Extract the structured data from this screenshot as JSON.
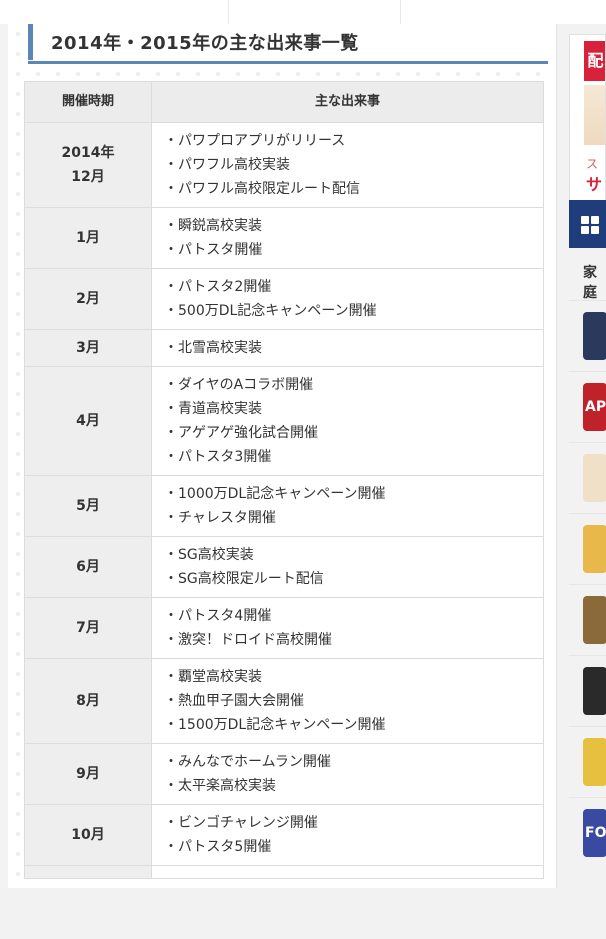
{
  "heading": {
    "title": "2014年・2015年の主な出来事一覧"
  },
  "table": {
    "headers": {
      "period": "開催時期",
      "events": "主な出来事"
    },
    "rows": [
      {
        "period": [
          "2014年",
          "12月"
        ],
        "events": [
          "・パワプロアプリがリリース",
          "・パワフル高校実装",
          "・パワフル高校限定ルート配信"
        ]
      },
      {
        "period": [
          "1月"
        ],
        "events": [
          "・瞬鋭高校実装",
          "・パトスタ開催"
        ]
      },
      {
        "period": [
          "2月"
        ],
        "events": [
          "・パトスタ2開催",
          "・500万DL記念キャンペーン開催"
        ]
      },
      {
        "period": [
          "3月"
        ],
        "events": [
          "・北雪高校実装"
        ]
      },
      {
        "period": [
          "4月"
        ],
        "events": [
          "・ダイヤのAコラボ開催",
          "・青道高校実装",
          "・アゲアゲ強化試合開催",
          "・パトスタ3開催"
        ]
      },
      {
        "period": [
          "5月"
        ],
        "events": [
          "・1000万DL記念キャンペーン開催",
          "・チャレスタ開催"
        ]
      },
      {
        "period": [
          "6月"
        ],
        "events": [
          "・SG高校実装",
          "・SG高校限定ルート配信"
        ]
      },
      {
        "period": [
          "7月"
        ],
        "events": [
          "・パトスタ4開催",
          "・激突！ドロイド高校開催"
        ]
      },
      {
        "period": [
          "8月"
        ],
        "events": [
          "・覇堂高校実装",
          "・熱血甲子園大会開催",
          "・1500万DL記念キャンペーン開催"
        ]
      },
      {
        "period": [
          "9月"
        ],
        "events": [
          "・みんなでホームラン開催",
          "・太平楽高校実装"
        ]
      },
      {
        "period": [
          "10月"
        ],
        "events": [
          "・ビンゴチャレンジ開催",
          "・パトスタ5開催"
        ]
      },
      {
        "period": [
          ""
        ],
        "events": [
          ""
        ]
      }
    ]
  },
  "sidebar": {
    "banner_text_top": "配",
    "banner_text_mid": "ス",
    "banner_text_bottom": "サ",
    "section_label": "家庭",
    "thumbs": [
      {
        "label": "",
        "color": "#2b3a5c"
      },
      {
        "label": "AP",
        "color": "#c0222a"
      },
      {
        "label": "",
        "color": "#f0e0c8"
      },
      {
        "label": "",
        "color": "#e8b84a"
      },
      {
        "label": "",
        "color": "#8a6a3a"
      },
      {
        "label": "",
        "color": "#2a2a2a"
      },
      {
        "label": "",
        "color": "#e8c040"
      },
      {
        "label": "FOR",
        "color": "#3a4aa0"
      }
    ]
  }
}
